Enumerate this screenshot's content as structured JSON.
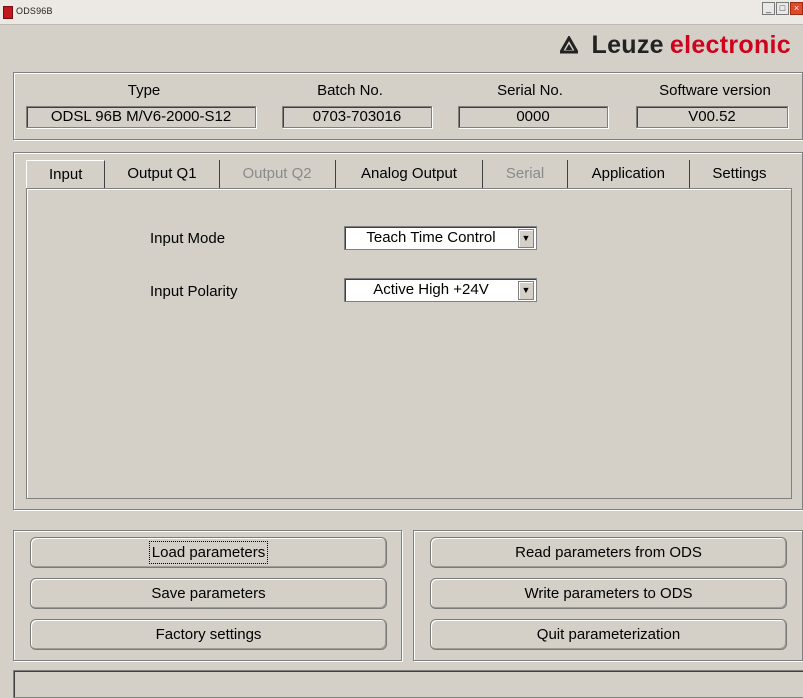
{
  "window": {
    "title": "ODS96B",
    "min_glyph": "_",
    "max_glyph": "□",
    "close_glyph": "×"
  },
  "brand": {
    "name": "Leuze",
    "suffix": "electronic",
    "logo_icon": "leuze-triangle-logo",
    "suffix_color": "#d0021b"
  },
  "info": {
    "type_label": "Type",
    "type_value": "ODSL 96B M/V6-2000-S12",
    "batch_label": "Batch No.",
    "batch_value": "0703-703016",
    "serial_label": "Serial No.",
    "serial_value": "0000",
    "software_label": "Software version",
    "software_value": "V00.52"
  },
  "tabs": [
    {
      "label": "Input",
      "state": "active"
    },
    {
      "label": "Output Q1",
      "state": "enabled"
    },
    {
      "label": "Output Q2",
      "state": "disabled"
    },
    {
      "label": "Analog Output",
      "state": "enabled"
    },
    {
      "label": "Serial",
      "state": "disabled"
    },
    {
      "label": "Application",
      "state": "enabled"
    },
    {
      "label": "Settings",
      "state": "enabled"
    }
  ],
  "input_tab": {
    "mode_label": "Input Mode",
    "mode_value": "Teach Time Control",
    "polarity_label": "Input Polarity",
    "polarity_value": "Active High +24V",
    "arrow_glyph": "▼"
  },
  "buttons": {
    "load": "Load parameters",
    "save": "Save parameters",
    "factory": "Factory settings",
    "read": "Read parameters from ODS",
    "write": "Write parameters to ODS",
    "quit": "Quit parameterization"
  },
  "status": {
    "text": ""
  }
}
